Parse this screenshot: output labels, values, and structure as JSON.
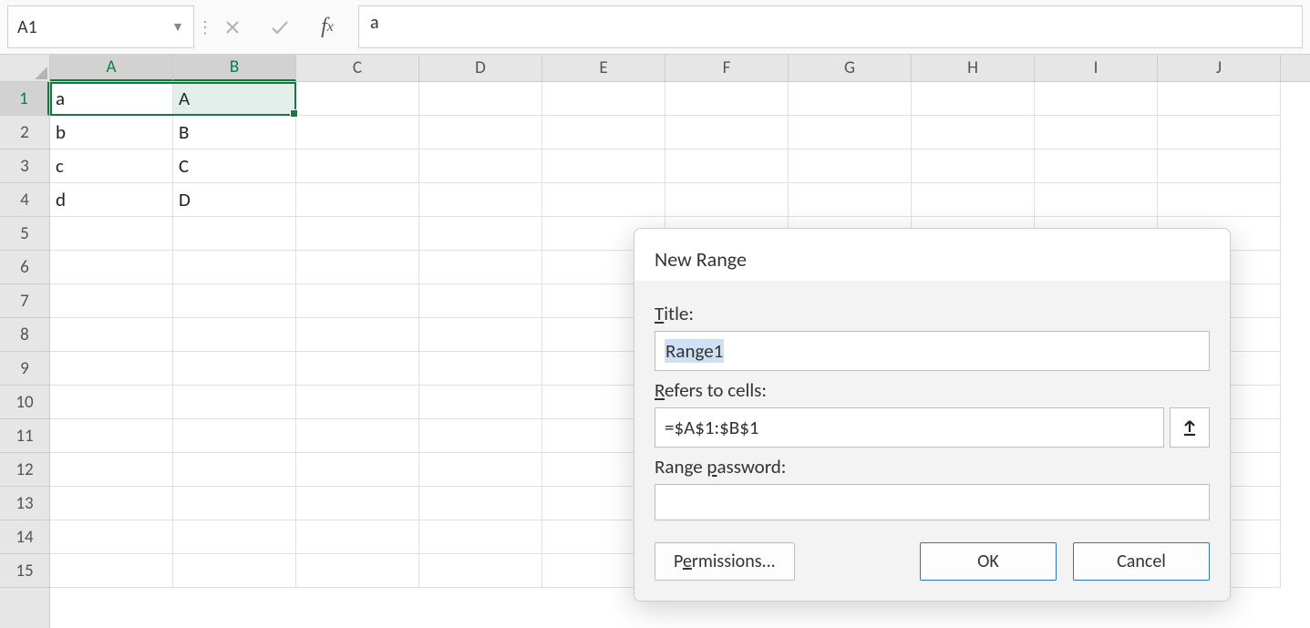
{
  "formula_bar": {
    "name_box": "A1",
    "formula_value": "a"
  },
  "columns": [
    "A",
    "B",
    "C",
    "D",
    "E",
    "F",
    "G",
    "H",
    "I",
    "J"
  ],
  "selected_cols": [
    "A",
    "B"
  ],
  "row_count": 15,
  "selected_rows": [
    1
  ],
  "cells": {
    "r1": {
      "A": "a",
      "B": "A"
    },
    "r2": {
      "A": "b",
      "B": "B"
    },
    "r3": {
      "A": "c",
      "B": "C"
    },
    "r4": {
      "A": "d",
      "B": "D"
    }
  },
  "dialog": {
    "title": "New Range",
    "labels": {
      "title": "Title:",
      "title_uchar": "T",
      "refers": "Refers to cells:",
      "refers_uchar": "R",
      "password": "Range password:",
      "password_uchar": "p"
    },
    "fields": {
      "title_value": "Range1",
      "refers_value": "=$A$1:$B$1",
      "password_value": ""
    },
    "buttons": {
      "permissions": "Permissions...",
      "permissions_uchar": "e",
      "ok": "OK",
      "cancel": "Cancel"
    }
  }
}
